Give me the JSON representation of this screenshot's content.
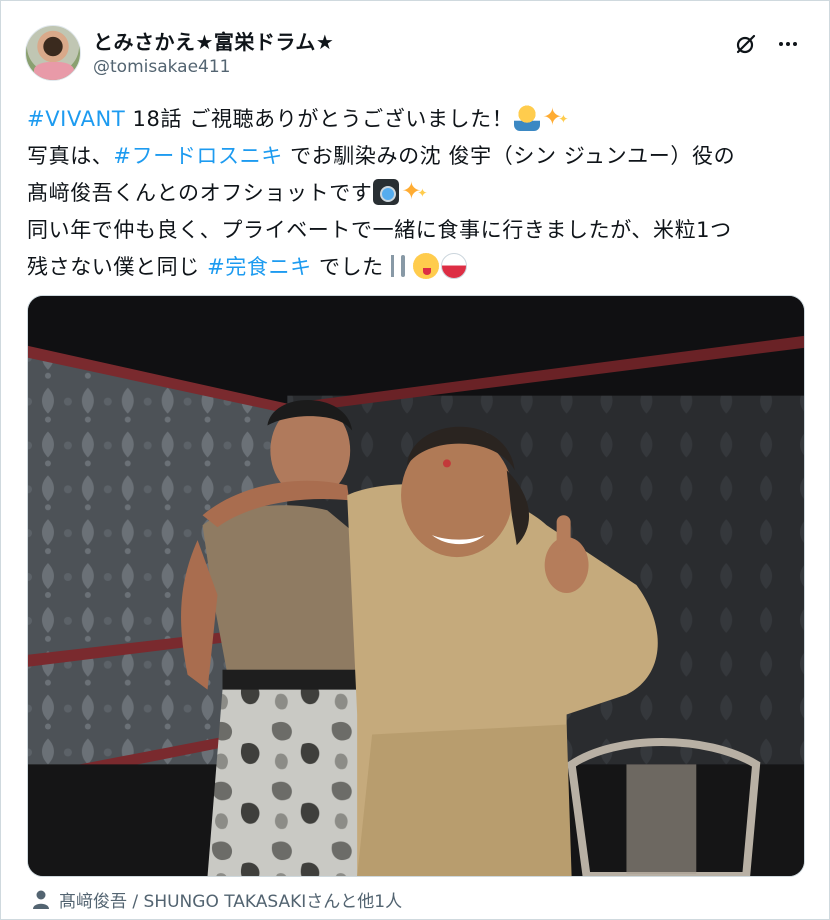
{
  "author": {
    "display_name": "とみさかえ★富栄ドラム★",
    "handle": "@tomisakae411"
  },
  "header_icons": {
    "grok": "grok-icon",
    "more": "more-icon"
  },
  "tweet": {
    "lines": [
      [
        {
          "type": "hashtag",
          "text": "#VIVANT"
        },
        {
          "type": "text",
          "text": " 18話 ご視聴ありがとうございました！"
        },
        {
          "type": "emoji",
          "icon": "person-bowing-emoji"
        },
        {
          "type": "emoji",
          "icon": "sparkles-emoji"
        }
      ],
      [
        {
          "type": "text",
          "text": "写真は、"
        },
        {
          "type": "hashtag",
          "text": "#フードロスニキ"
        },
        {
          "type": "text",
          "text": " でお馴染みの沈 俊宇（シン ジュンユー）役の"
        }
      ],
      [
        {
          "type": "text",
          "text": "髙﨑俊吾くんとのオフショットです"
        },
        {
          "type": "emoji",
          "icon": "camera-flash-emoji"
        },
        {
          "type": "emoji",
          "icon": "sparkles-emoji"
        }
      ],
      [
        {
          "type": "text",
          "text": "同い年で仲も良く、プライベートで一緒に食事に行きましたが、米粒1つ"
        }
      ],
      [
        {
          "type": "text",
          "text": "残さない僕と同じ "
        },
        {
          "type": "hashtag",
          "text": "#完食ニキ"
        },
        {
          "type": "text",
          "text": " でした"
        },
        {
          "type": "emoji",
          "icon": "fork-knife-emoji"
        },
        {
          "type": "emoji",
          "icon": "yum-face-emoji"
        },
        {
          "type": "emoji",
          "icon": "rice-bowl-emoji"
        }
      ]
    ]
  },
  "media": {
    "icon": "photo-two-men-backstage"
  },
  "tagged": {
    "icon": "person-icon",
    "text": "髙﨑俊吾 / SHUNGO TAKASAKIさんと他1人"
  },
  "colors": {
    "link": "#1d9bf0",
    "secondary_text": "#536471",
    "border": "#cfd9de"
  }
}
